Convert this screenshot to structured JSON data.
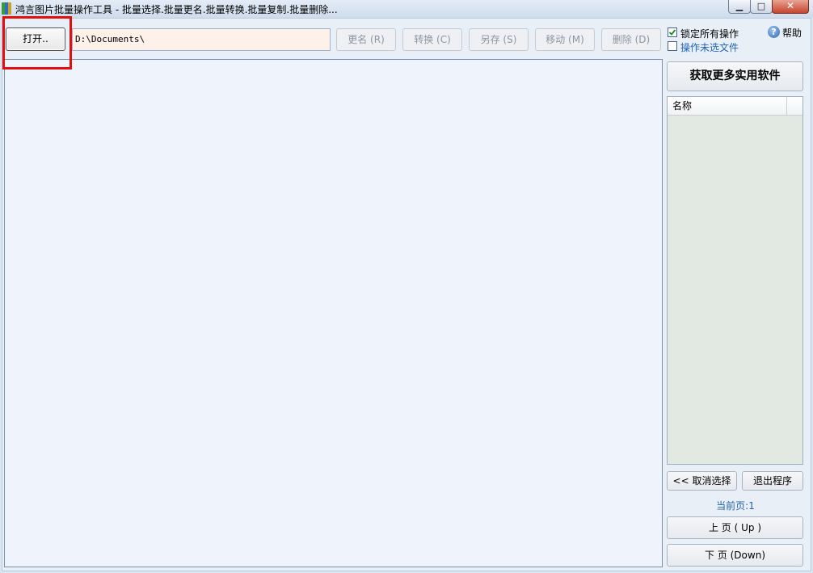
{
  "window": {
    "title": "鸿言图片批量操作工具 - 批量选择.批量更名.批量转换.批量复制.批量删除...",
    "minimize_glyph": "▁",
    "maximize_glyph": "□",
    "close_glyph": "✕"
  },
  "toolbar": {
    "open_label": "打开..",
    "path_value": "D:\\Documents\\",
    "rename_label": "更名 (R)",
    "convert_label": "转换 (C)",
    "save_as_label": "另存 (S)",
    "move_label": "移动 (M)",
    "delete_label": "删除 (D)"
  },
  "options": {
    "lock_all_label": "锁定所有操作",
    "lock_all_checked": true,
    "operate_unselected_label": "操作未选文件",
    "operate_unselected_checked": false,
    "help_label": "帮助"
  },
  "sidebar": {
    "more_software_label": "获取更多实用软件",
    "list_column_header": "名称",
    "cancel_selection_label": "<< 取消选择",
    "exit_label": "退出程序",
    "current_page_label": "当前页:1",
    "page_up_label": "上  页 ( Up )",
    "page_down_label": "下  页 (Down)"
  },
  "icons": {
    "app": "app-icon",
    "help": "help-icon",
    "check": "checkmark-icon"
  },
  "colors": {
    "highlight_box": "#e30f0f",
    "link_text": "#1f63b8",
    "path_field_bg": "#fdf1ea",
    "file_pane_bg": "#eef3fc"
  }
}
